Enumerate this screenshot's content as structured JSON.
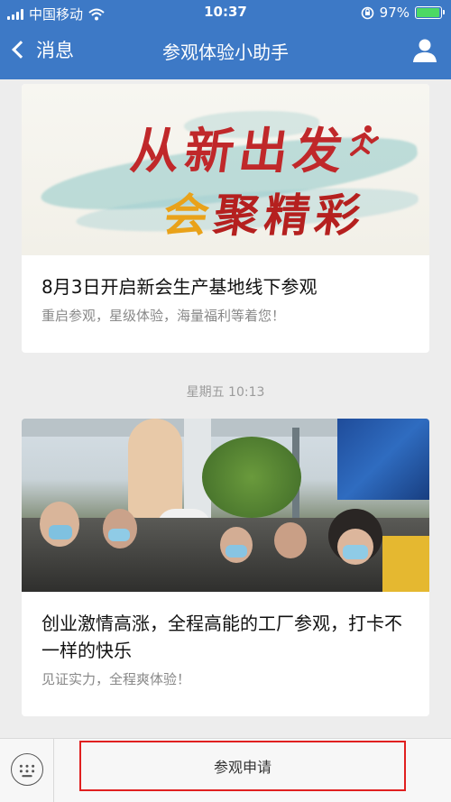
{
  "status_bar": {
    "carrier": "中国移动",
    "time": "10:37",
    "battery": "97%",
    "battery_level": 0.97,
    "icons": [
      "signal-icon",
      "wifi-icon",
      "rotation-lock-icon",
      "battery-icon"
    ]
  },
  "nav": {
    "back_label": "消息",
    "title": "参观体验小助手",
    "icons": [
      "chevron-left-icon",
      "user-icon"
    ]
  },
  "cards": [
    {
      "banner_text_line1": "从新出发",
      "banner_text_line2_gold": "会",
      "banner_text_line2": "聚精彩",
      "title": "8月3日开启新会生产基地线下参观",
      "subtitle": "重启参观，星级体验，海量福利等着您！"
    },
    {
      "title": "创业激情高涨，全程高能的工厂参观，打卡不一样的快乐",
      "subtitle": "见证实力，全程爽体验！"
    }
  ],
  "timestamp": "星期五 10:13",
  "bottom_bar": {
    "apply_label": "参观申请",
    "icons": [
      "keyboard-icon"
    ]
  },
  "colors": {
    "nav_bg": "#3d79c6",
    "page_bg": "#ededed",
    "highlight_border": "#e02020",
    "battery_fill": "#4cd964"
  }
}
